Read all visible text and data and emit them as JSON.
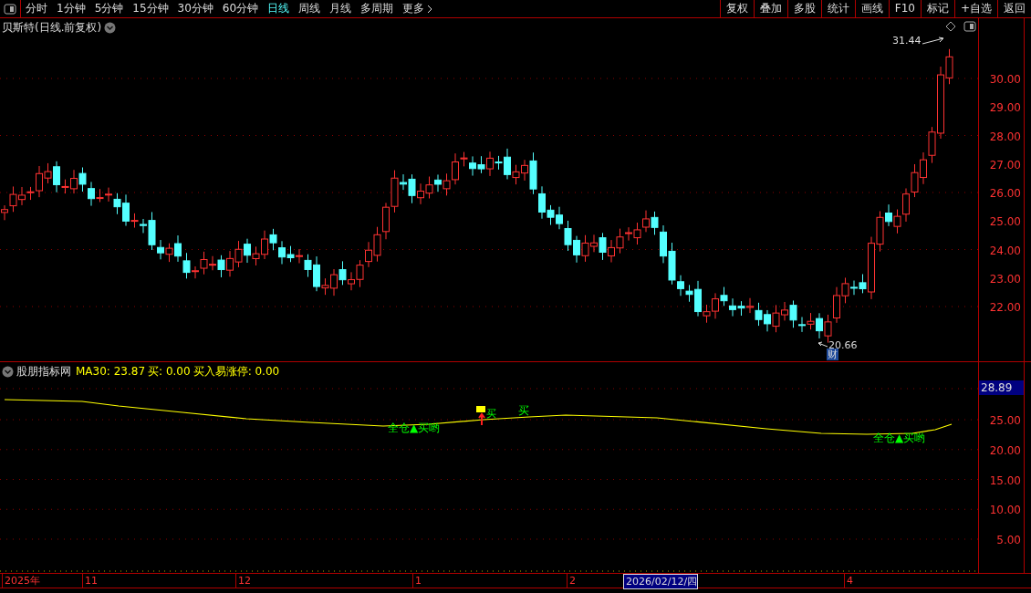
{
  "toolbar": {
    "periods": [
      {
        "label": "分时",
        "selected": false
      },
      {
        "label": "1分钟",
        "selected": false
      },
      {
        "label": "5分钟",
        "selected": false
      },
      {
        "label": "15分钟",
        "selected": false
      },
      {
        "label": "30分钟",
        "selected": false
      },
      {
        "label": "60分钟",
        "selected": false
      },
      {
        "label": "日线",
        "selected": true
      },
      {
        "label": "周线",
        "selected": false
      },
      {
        "label": "月线",
        "selected": false
      },
      {
        "label": "多周期",
        "selected": false
      }
    ],
    "more": "更多",
    "tools": [
      "复权",
      "叠加",
      "多股",
      "统计",
      "画线",
      "F10",
      "标记",
      "+自选",
      "返回"
    ]
  },
  "main_chart": {
    "title": "贝斯特(日线.前复权)",
    "high_label": "31.44",
    "low_label": "20.66",
    "event_marker": "财",
    "price_ticks": [
      "30.00",
      "29.00",
      "28.00",
      "27.00",
      "26.00",
      "25.00",
      "24.00",
      "23.00",
      "22.00"
    ]
  },
  "indicator": {
    "name": "股朋指标网",
    "readouts": [
      "MA30: 23.87",
      "买: 0.00",
      "买入易涨停: 0.00"
    ],
    "current_value": "28.89",
    "value_ticks": [
      "25.00",
      "20.00",
      "15.00",
      "10.00",
      "5.00"
    ],
    "signals": [
      {
        "kind": "buy-all",
        "text": "全仓▲买哟"
      },
      {
        "kind": "buy-flag",
        "text": "买"
      },
      {
        "kind": "buy",
        "text": "买"
      },
      {
        "kind": "buy-all",
        "text": "全仓▲买哟"
      }
    ]
  },
  "date_axis": {
    "labels": [
      {
        "text": "2025年",
        "selected": false
      },
      {
        "text": "11",
        "selected": false
      },
      {
        "text": "12",
        "selected": false
      },
      {
        "text": "1",
        "selected": false
      },
      {
        "text": "2",
        "selected": false
      },
      {
        "text": "2026/02/12/四",
        "selected": true
      },
      {
        "text": "4",
        "selected": false
      }
    ]
  }
}
